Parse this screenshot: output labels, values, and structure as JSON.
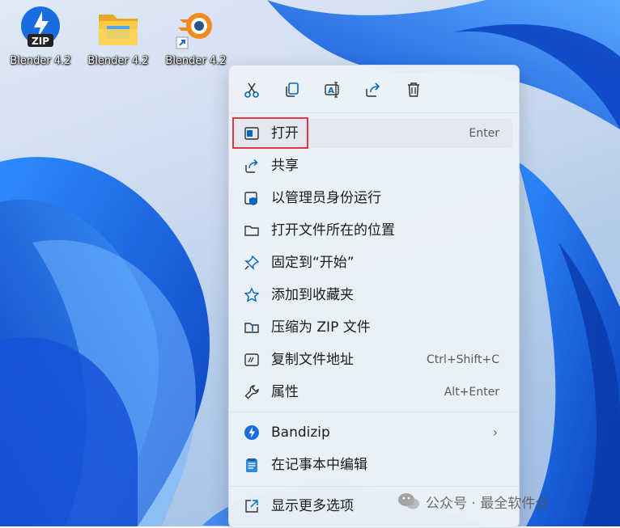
{
  "desktop": {
    "icons": [
      {
        "label": "Blender 4.2",
        "icon": "bandizip-zip-icon"
      },
      {
        "label": "Blender 4.2",
        "icon": "folder-icon"
      },
      {
        "label": "Blender 4.2",
        "icon": "blender-shortcut-icon"
      }
    ]
  },
  "context_menu": {
    "toolbar": [
      {
        "name": "cut",
        "icon": "scissors-icon"
      },
      {
        "name": "copy",
        "icon": "copy-icon"
      },
      {
        "name": "rename",
        "icon": "rename-icon"
      },
      {
        "name": "share",
        "icon": "share-icon"
      },
      {
        "name": "delete",
        "icon": "trash-icon"
      }
    ],
    "items": [
      {
        "label": "打开",
        "shortcut": "Enter",
        "icon": "open-window-icon",
        "highlighted": true
      },
      {
        "label": "共享",
        "shortcut": "",
        "icon": "share-icon"
      },
      {
        "label": "以管理员身份运行",
        "shortcut": "",
        "icon": "admin-shield-icon"
      },
      {
        "label": "打开文件所在的位置",
        "shortcut": "",
        "icon": "folder-outline-icon"
      },
      {
        "label": "固定到“开始”",
        "shortcut": "",
        "icon": "pin-icon"
      },
      {
        "label": "添加到收藏夹",
        "shortcut": "",
        "icon": "star-icon"
      },
      {
        "label": "压缩为 ZIP 文件",
        "shortcut": "",
        "icon": "zip-folder-icon"
      },
      {
        "label": "复制文件地址",
        "shortcut": "Ctrl+Shift+C",
        "icon": "copy-path-icon"
      },
      {
        "label": "属性",
        "shortcut": "Alt+Enter",
        "icon": "wrench-icon"
      },
      {
        "label": "Bandizip",
        "shortcut": "",
        "icon": "bandizip-icon",
        "submenu": true
      },
      {
        "label": "在记事本中编辑",
        "shortcut": "",
        "icon": "notepad-icon"
      },
      {
        "label": "显示更多选项",
        "shortcut": "",
        "icon": "more-options-icon"
      }
    ]
  },
  "watermark": {
    "text": "公众号 · 最全软件仓",
    "icon": "wechat-icon"
  },
  "colors": {
    "accent": "#0067c0",
    "highlight_box": "#e0383e"
  }
}
